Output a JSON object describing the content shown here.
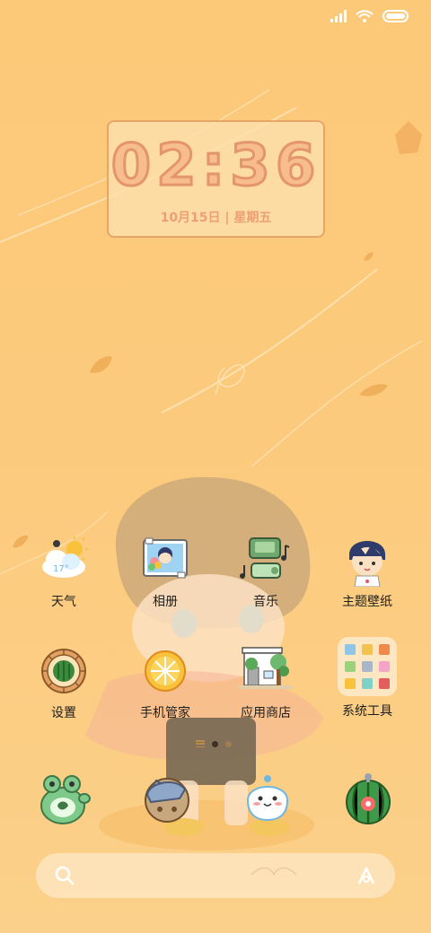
{
  "clock": {
    "time": "02:36",
    "date": "10月15日 | 星期五"
  },
  "apps_row1": [
    {
      "label": "天气",
      "icon": "weather-icon"
    },
    {
      "label": "相册",
      "icon": "gallery-icon"
    },
    {
      "label": "音乐",
      "icon": "music-icon"
    },
    {
      "label": "主题壁纸",
      "icon": "themes-icon"
    }
  ],
  "apps_row2": [
    {
      "label": "设置",
      "icon": "settings-icon"
    },
    {
      "label": "手机管家",
      "icon": "security-icon"
    },
    {
      "label": "应用商店",
      "icon": "app-store-icon"
    },
    {
      "label": "系统工具",
      "icon": "tools-folder-icon"
    }
  ],
  "weather_icon_temp": "17°",
  "dock": [
    "phone-icon",
    "messages-icon",
    "browser-icon",
    "camera-icon"
  ],
  "page_indicator": {
    "pages": 2,
    "current": 1
  },
  "colors": {
    "background": "#fbc978",
    "clock_border": "#e7a56a",
    "clock_text": "#f7bd8c"
  }
}
